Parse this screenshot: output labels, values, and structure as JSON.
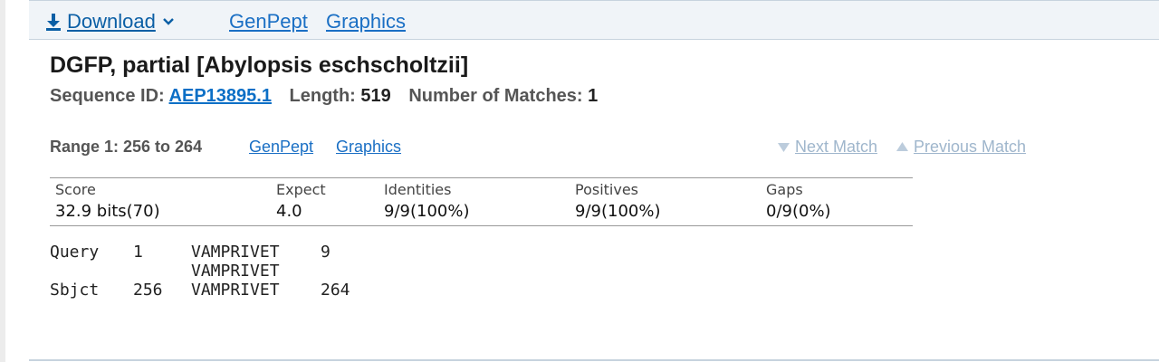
{
  "toolbar": {
    "download_label": "Download",
    "genpept_label": "GenPept",
    "graphics_label": "Graphics"
  },
  "hit": {
    "title": "DGFP, partial [Abylopsis eschscholtzii]",
    "seq_id_label": "Sequence ID:",
    "seq_id": "AEP13895.1",
    "length_label": "Length:",
    "length": "519",
    "matches_label": "Number of Matches:",
    "matches": "1"
  },
  "range": {
    "label": "Range 1: 256 to 264",
    "genpept_label": "GenPept",
    "graphics_label": "Graphics",
    "next_label": "Next Match",
    "prev_label": "Previous Match"
  },
  "stats": {
    "headers": [
      "Score",
      "Expect",
      "Identities",
      "Positives",
      "Gaps"
    ],
    "values": [
      "32.9 bits(70)",
      "4.0",
      "9/9(100%)",
      "9/9(100%)",
      "0/9(0%)"
    ]
  },
  "alignment": {
    "query_label": "Query",
    "query_start": "1",
    "query_seq": "VAMPRIVET",
    "query_end": "9",
    "midline": "VAMPRIVET",
    "sbjct_label": "Sbjct",
    "sbjct_start": "256",
    "sbjct_seq": "VAMPRIVET",
    "sbjct_end": "264"
  },
  "colors": {
    "link": "#1a6fc4",
    "toolbar_bg": "#f0f4f8",
    "disabled_link": "#9fb6cc"
  },
  "icons": {
    "download": "download-icon",
    "dropdown": "chevron-down-icon",
    "next": "triangle-down-icon",
    "prev": "triangle-up-icon"
  }
}
